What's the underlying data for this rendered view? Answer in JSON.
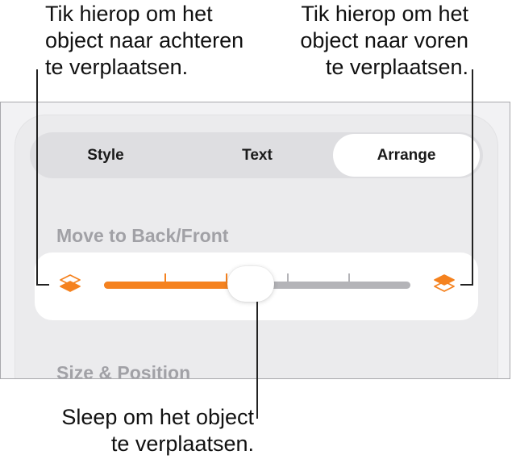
{
  "callouts": {
    "left": "Tik hierop om het\nobject naar achteren\nte verplaatsen.",
    "right": "Tik hierop om het\nobject naar voren\nte verplaatsen.",
    "bottom": "Sleep om het object\nte verplaatsen."
  },
  "tabs": {
    "style": "Style",
    "text": "Text",
    "arrange": "Arrange",
    "selected": "Arrange"
  },
  "sections": {
    "move": "Move to Back/Front",
    "size": "Size & Position"
  },
  "slider": {
    "value_fraction": 0.48,
    "tick_count": 6
  },
  "icons": {
    "back": "send-to-back-icon",
    "front": "bring-to-front-icon"
  },
  "colors": {
    "accent": "#f5821f",
    "track": "#b4b4b8",
    "section_title": "#a1a1a6"
  }
}
